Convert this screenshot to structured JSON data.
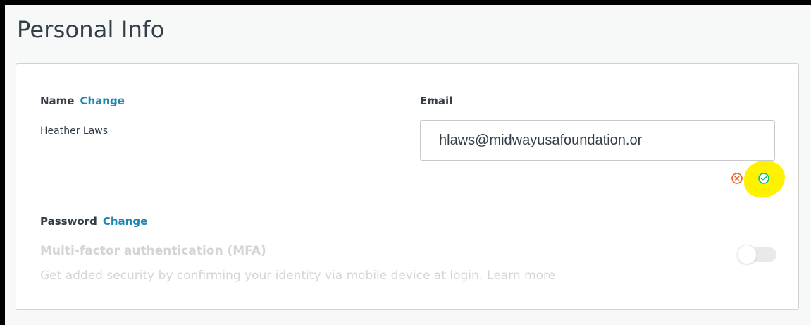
{
  "page": {
    "title": "Personal Info"
  },
  "name_section": {
    "label": "Name",
    "change_link": "Change",
    "value": "Heather Laws"
  },
  "email_section": {
    "label": "Email",
    "value": "hlaws@midwayusafoundation.or",
    "cancel_icon": "x-circle-icon",
    "confirm_icon": "check-circle-icon"
  },
  "password_section": {
    "label": "Password",
    "change_link": "Change"
  },
  "mfa_section": {
    "title": "Multi-factor authentication (MFA)",
    "description": "Get added security by confirming your identity via mobile device at login.",
    "learn_more": "Learn more",
    "enabled": false
  },
  "colors": {
    "link": "#1e86b3",
    "cancel": "#f05b24",
    "confirm": "#00bf6f",
    "highlight": "#fff200",
    "disabled_text": "#d3d5d6"
  }
}
